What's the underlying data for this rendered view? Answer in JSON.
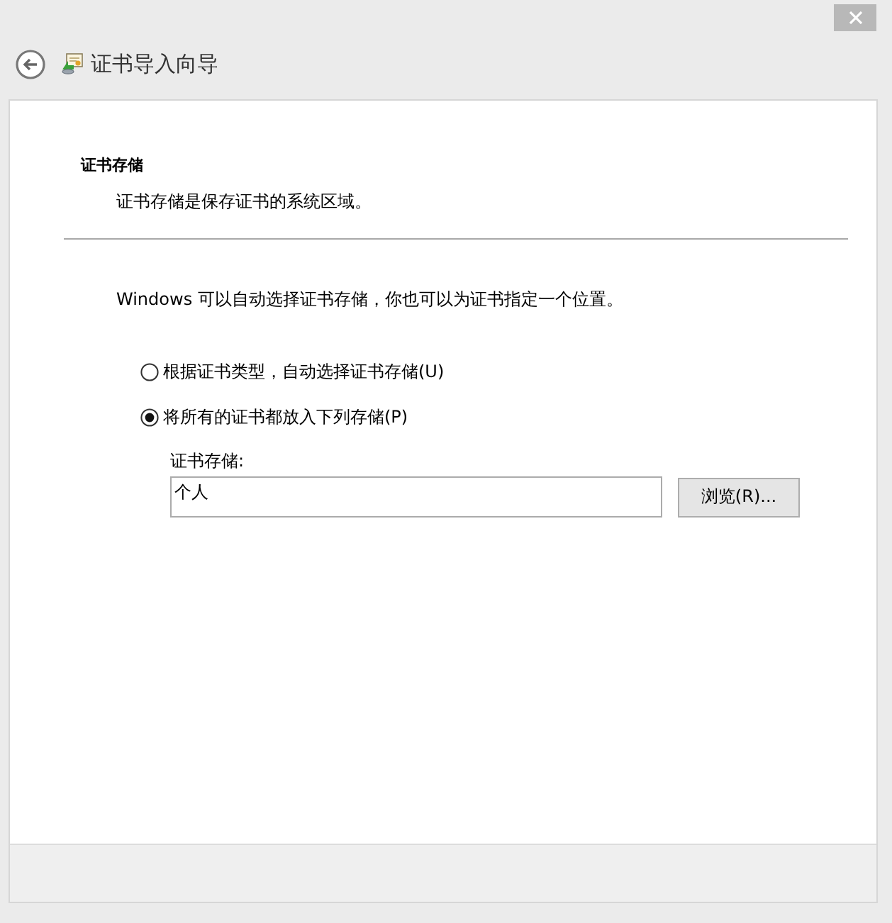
{
  "window": {
    "title": "证书导入向导"
  },
  "page": {
    "heading": "证书存储",
    "description": "证书存储是保存证书的系统区域。"
  },
  "intro": "Windows 可以自动选择证书存储，你也可以为证书指定一个位置。",
  "options": [
    {
      "label": "根据证书类型，自动选择证书存储(U)",
      "selected": false
    },
    {
      "label": "将所有的证书都放入下列存储(P)",
      "selected": true
    }
  ],
  "store_field": {
    "label": "证书存储:",
    "value": "个人"
  },
  "browse_button": "浏览(R)..."
}
